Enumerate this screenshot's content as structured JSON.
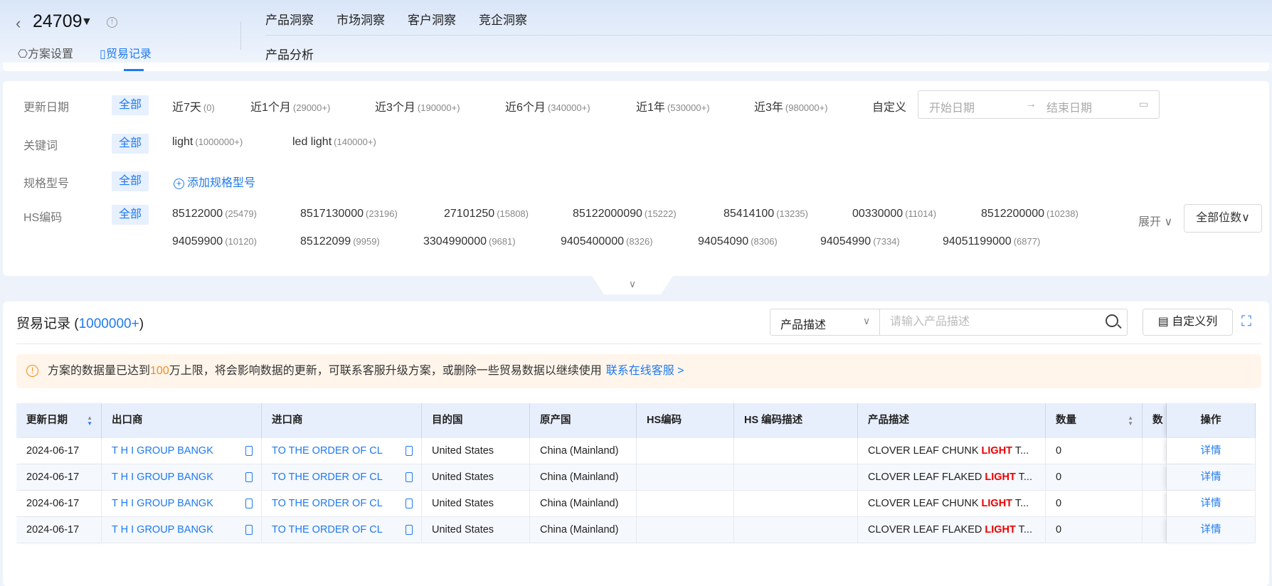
{
  "header": {
    "plan_id": "24709",
    "tabs_top": [
      "产品洞察",
      "市场洞察",
      "客户洞察",
      "竞企洞察"
    ],
    "tab_sub": "产品分析",
    "plan_settings": "方案设置",
    "trade_records": "贸易记录"
  },
  "filters": {
    "update_date": {
      "label": "更新日期",
      "all": "全部",
      "options": [
        {
          "t": "近7天",
          "c": "(0)"
        },
        {
          "t": "近1个月",
          "c": "(29000+)"
        },
        {
          "t": "近3个月",
          "c": "(190000+)"
        },
        {
          "t": "近6个月",
          "c": "(340000+)"
        },
        {
          "t": "近1年",
          "c": "(530000+)"
        },
        {
          "t": "近3年",
          "c": "(980000+)"
        }
      ],
      "custom": "自定义",
      "start_placeholder": "开始日期",
      "end_placeholder": "结束日期"
    },
    "keyword": {
      "label": "关键词",
      "all": "全部",
      "options": [
        {
          "t": "light",
          "c": "(1000000+)"
        },
        {
          "t": "led light",
          "c": "(140000+)"
        }
      ]
    },
    "spec": {
      "label": "规格型号",
      "all": "全部",
      "add": "添加规格型号"
    },
    "hs": {
      "label": "HS编码",
      "all": "全部",
      "row1": [
        {
          "t": "85122000",
          "c": "(25479)"
        },
        {
          "t": "8517130000",
          "c": "(23196)"
        },
        {
          "t": "27101250",
          "c": "(15808)"
        },
        {
          "t": "85122000090",
          "c": "(15222)"
        },
        {
          "t": "85414100",
          "c": "(13235)"
        },
        {
          "t": "00330000",
          "c": "(11014)"
        },
        {
          "t": "8512200000",
          "c": "(10238)"
        }
      ],
      "row2": [
        {
          "t": "94059900",
          "c": "(10120)"
        },
        {
          "t": "85122099",
          "c": "(9959)"
        },
        {
          "t": "3304990000",
          "c": "(9681)"
        },
        {
          "t": "9405400000",
          "c": "(8326)"
        },
        {
          "t": "94054090",
          "c": "(8306)"
        },
        {
          "t": "94054990",
          "c": "(7334)"
        },
        {
          "t": "94051199000",
          "c": "(6877)"
        }
      ],
      "expand": "展开",
      "digits": "全部位数"
    }
  },
  "records": {
    "title": "贸易记录 (",
    "count": "1000000+",
    "close": ")",
    "search_field": "产品描述",
    "search_placeholder": "请输入产品描述",
    "custom_columns": "自定义列",
    "alert": {
      "pre": "方案的数据量已达到",
      "hl": "100",
      "post": "万上限，将会影响数据的更新，可联系客服升级方案，或删除一些贸易数据以继续使用",
      "link": "联系在线客服 >"
    },
    "columns": [
      "更新日期",
      "出口商",
      "进口商",
      "目的国",
      "原产国",
      "HS编码",
      "HS 编码描述",
      "产品描述",
      "数量",
      "数",
      "操作"
    ],
    "rows": [
      {
        "date": "2024-06-17",
        "exporter": "T H I GROUP BANGK",
        "importer": "TO THE ORDER OF CL",
        "dest": "United States",
        "origin": "China (Mainland)",
        "hs": "",
        "hsdesc": "",
        "desc_a": "CLOVER LEAF CHUNK ",
        "desc_hl": "LIGHT",
        "desc_b": " T...",
        "qty": "0",
        "action": "详情"
      },
      {
        "date": "2024-06-17",
        "exporter": "T H I GROUP BANGK",
        "importer": "TO THE ORDER OF CL",
        "dest": "United States",
        "origin": "China (Mainland)",
        "hs": "",
        "hsdesc": "",
        "desc_a": "CLOVER LEAF FLAKED ",
        "desc_hl": "LIGHT",
        "desc_b": " T...",
        "qty": "0",
        "action": "详情"
      },
      {
        "date": "2024-06-17",
        "exporter": "T H I GROUP BANGK",
        "importer": "TO THE ORDER OF CL",
        "dest": "United States",
        "origin": "China (Mainland)",
        "hs": "",
        "hsdesc": "",
        "desc_a": "CLOVER LEAF CHUNK ",
        "desc_hl": "LIGHT",
        "desc_b": " T...",
        "qty": "0",
        "action": "详情"
      },
      {
        "date": "2024-06-17",
        "exporter": "T H I GROUP BANGK",
        "importer": "TO THE ORDER OF CL",
        "dest": "United States",
        "origin": "China (Mainland)",
        "hs": "",
        "hsdesc": "",
        "desc_a": "CLOVER LEAF FLAKED ",
        "desc_hl": "LIGHT",
        "desc_b": " T...",
        "qty": "0",
        "action": "详情"
      }
    ]
  },
  "colors": {
    "accent": "#1f7af0",
    "highlight": "#e00000",
    "warning": "#f08c1a"
  }
}
